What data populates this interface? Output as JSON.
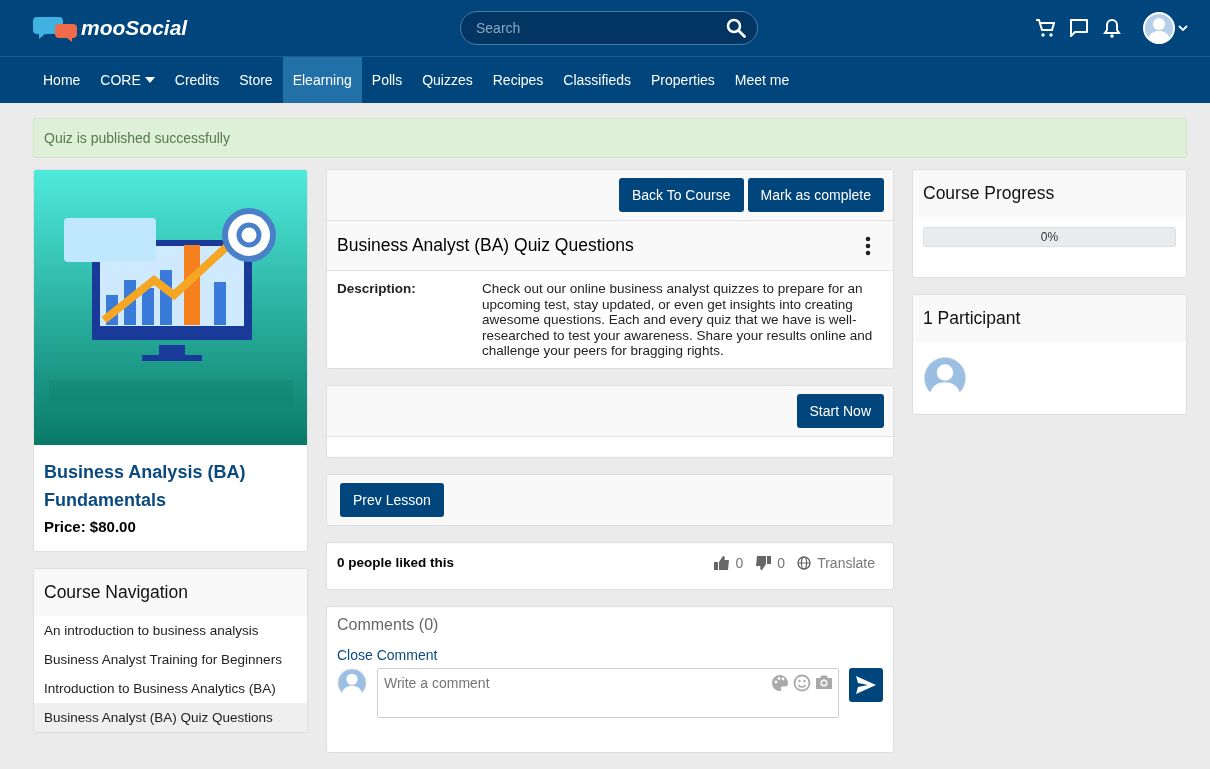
{
  "header": {
    "logo": "mooSocial",
    "search": {
      "placeholder": "Search"
    }
  },
  "nav": [
    {
      "label": "Home",
      "selected": false,
      "dropdown": false
    },
    {
      "label": "CORE",
      "selected": false,
      "dropdown": true
    },
    {
      "label": "Credits",
      "selected": false,
      "dropdown": false
    },
    {
      "label": "Store",
      "selected": false,
      "dropdown": false
    },
    {
      "label": "Elearning",
      "selected": true,
      "dropdown": false
    },
    {
      "label": "Polls",
      "selected": false,
      "dropdown": false
    },
    {
      "label": "Quizzes",
      "selected": false,
      "dropdown": false
    },
    {
      "label": "Recipes",
      "selected": false,
      "dropdown": false
    },
    {
      "label": "Classifieds",
      "selected": false,
      "dropdown": false
    },
    {
      "label": "Properties",
      "selected": false,
      "dropdown": false
    },
    {
      "label": "Meet me",
      "selected": false,
      "dropdown": false
    }
  ],
  "alert": "Quiz is published successfully",
  "course": {
    "title": "Business Analysis (BA) Fundamentals",
    "price": "Price: $80.00"
  },
  "course_navigation": {
    "title": "Course Navigation",
    "items": [
      {
        "label": "An introduction to business analysis",
        "selected": false
      },
      {
        "label": "Business Analyst Training for Beginners",
        "selected": false
      },
      {
        "label": "Introduction to Business Analytics (BA)",
        "selected": false
      },
      {
        "label": "Business Analyst (BA) Quiz Questions",
        "selected": true
      }
    ]
  },
  "lesson": {
    "buttons": [
      "Back To Course",
      "Mark as complete"
    ],
    "title": "Business Analyst (BA) Quiz Questions",
    "description_label": "Description:",
    "description": "Check out our online business analyst quizzes to prepare for an upcoming test, stay updated, or even get insights into creating awesome questions. Each and every quiz that we have is well-researched to test your awareness. Share your results online and challenge your peers for bragging rights."
  },
  "start_button": "Start Now",
  "prev_button": "Prev Lesson",
  "likes": {
    "text": "0 people liked this",
    "likes": "0",
    "dislikes": "0",
    "translate": "Translate"
  },
  "comments": {
    "title": "Comments (0)",
    "close": "Close Comment",
    "placeholder": "Write a comment"
  },
  "progress": {
    "title": "Course Progress",
    "level": 0,
    "reading": "0%"
  },
  "participants": {
    "title": "1 Participant"
  }
}
